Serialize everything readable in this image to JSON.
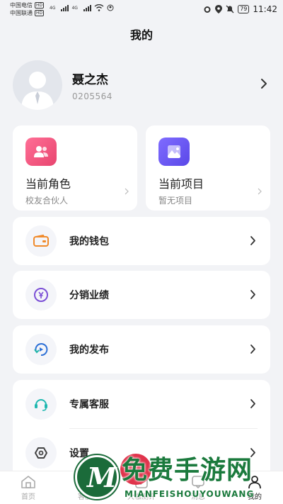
{
  "status_bar": {
    "carrier1": "中国电信",
    "carrier2": "中国联通",
    "hd": "HD",
    "network1": "4G",
    "network2": "4G",
    "battery": "79",
    "time": "11:42"
  },
  "page": {
    "title": "我的"
  },
  "profile": {
    "name": "聂之杰",
    "id": "0205564"
  },
  "cards": [
    {
      "title": "当前角色",
      "subtitle": "校友合伙人",
      "icon": "users-icon",
      "color": "#f0557d"
    },
    {
      "title": "当前项目",
      "subtitle": "暂无项目",
      "icon": "project-icon",
      "color": "#6a5cf6"
    }
  ],
  "menu": [
    {
      "label": "我的钱包",
      "icon": "wallet-icon",
      "color": "#f08a2b"
    },
    {
      "label": "分销业绩",
      "icon": "yen-icon",
      "color": "#7b4fd6"
    },
    {
      "label": "我的发布",
      "icon": "publish-icon",
      "color": "#2c6fd6"
    },
    {
      "label": "专属客服",
      "icon": "headset-icon",
      "color": "#20b8b0"
    },
    {
      "label": "设置",
      "icon": "settings-icon",
      "color": "#444444"
    }
  ],
  "tabbar": [
    {
      "label": "首页",
      "icon": "home-icon",
      "active": false
    },
    {
      "label": "客服",
      "icon": "service-icon",
      "active": false
    },
    {
      "label": "大咖测评",
      "icon": "review-icon",
      "active": false
    },
    {
      "label": "消息",
      "icon": "message-icon",
      "active": false
    },
    {
      "label": "我的",
      "icon": "profile-icon",
      "active": true
    }
  ],
  "watermark": {
    "logo_letter": "M",
    "title": "免费手游网",
    "subtitle": "MIANFEISHOUYOUWANG"
  }
}
